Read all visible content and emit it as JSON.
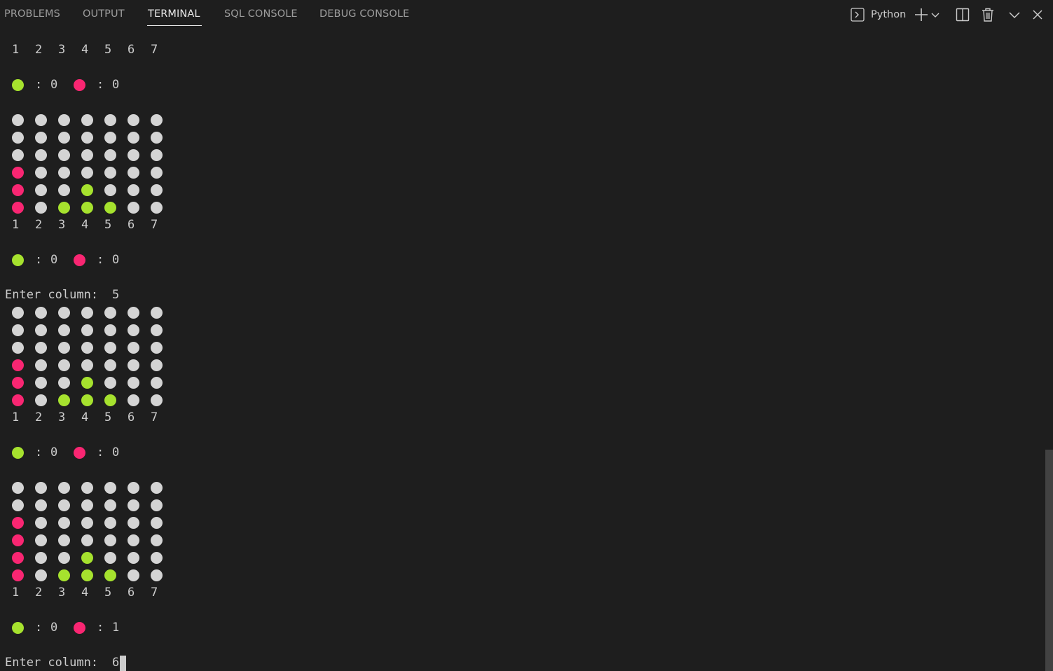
{
  "tabs": {
    "problems": "PROBLEMS",
    "output": "OUTPUT",
    "terminal": "TERMINAL",
    "sql_console": "SQL CONSOLE",
    "debug_console": "DEBUG CONSOLE",
    "active": "TERMINAL"
  },
  "toolbar": {
    "shell_label": "Python",
    "icons": [
      "terminal-icon",
      "plus-icon",
      "chevron-down-icon",
      "split-icon",
      "trash-icon",
      "chevron-down-icon",
      "close-icon"
    ]
  },
  "colors": {
    "background": "#1e1e1e",
    "text": "#cccccc",
    "empty_piece": "#d4d4d4",
    "green_piece": "#a6e22e",
    "red_piece": "#f92672"
  },
  "terminal": {
    "column_header": [
      "1",
      "2",
      "3",
      "4",
      "5",
      "6",
      "7"
    ],
    "prompt": "Enter column: ",
    "score_sep": ":",
    "boards": [
      {
        "rows": null,
        "score": {
          "green": "0",
          "red": "0"
        }
      },
      {
        "rows": [
          "eeeeeee",
          "eeeeeee",
          "eeeeeee",
          "reeeeee",
          "reegeee",
          "regggee"
        ],
        "rows_note": null,
        "score": {
          "green": "0",
          "red": "0"
        },
        "input": "5"
      },
      {
        "rows": [
          "eeeeeee",
          "eeeeeee",
          "eeeeeee",
          "reeeeee",
          "reegeee",
          "reggge e"
        ],
        "score": {
          "green": "0",
          "red": "0"
        }
      },
      {
        "rows": [
          "eeeeeee",
          "eeeeeee",
          "reeeeee",
          "reeeeee",
          "reegeee",
          "regggee"
        ],
        "score": {
          "green": "0",
          "red": "1"
        },
        "input": "6"
      }
    ]
  }
}
